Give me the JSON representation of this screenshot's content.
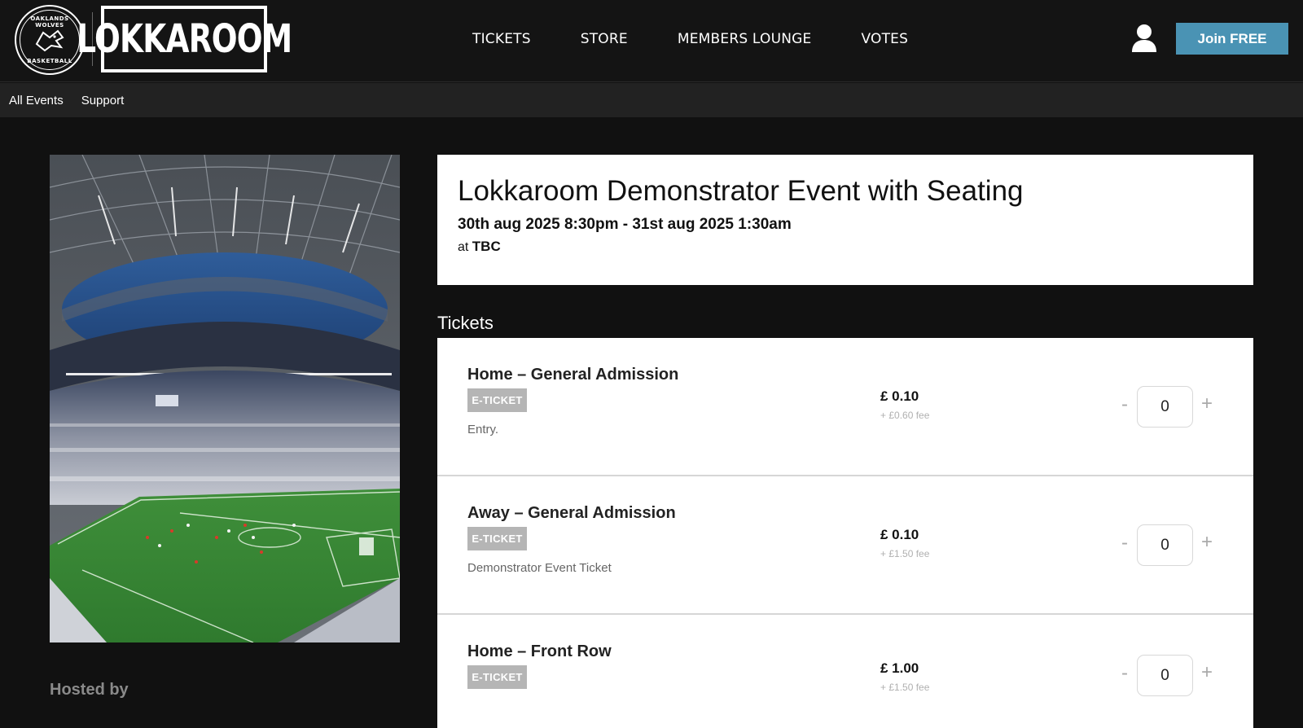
{
  "header": {
    "club_logo": {
      "top_text": "OAKLANDS WOLVES",
      "bottom_text": "BASKETBALL"
    },
    "brand": "LOKKAROOM",
    "nav": [
      "TICKETS",
      "STORE",
      "MEMBERS LOUNGE",
      "VOTES"
    ],
    "user_icon": "user-icon",
    "join_label": "Join FREE",
    "accent_color": "#4a93b4"
  },
  "subnav": [
    "All Events",
    "Support"
  ],
  "event": {
    "title": "Lokkaroom Demonstrator Event with Seating",
    "dates": "30th aug 2025 8:30pm - 31st aug 2025 1:30am",
    "venue_prefix": "at",
    "venue": "TBC"
  },
  "tickets_heading": "Tickets",
  "tickets": [
    {
      "name": "Home – General Admission",
      "badge": "E-TICKET",
      "description": "Entry.",
      "price": "£ 0.10",
      "fee": "+ £0.60 fee",
      "qty": "0",
      "minus": "-",
      "plus": "+"
    },
    {
      "name": "Away – General Admission",
      "badge": "E-TICKET",
      "description": "Demonstrator Event Ticket",
      "price": "£ 0.10",
      "fee": "+ £1.50 fee",
      "qty": "0",
      "minus": "-",
      "plus": "+"
    },
    {
      "name": "Home – Front Row",
      "badge": "E-TICKET",
      "description": "",
      "price": "£ 1.00",
      "fee": "+ £1.50 fee",
      "qty": "0",
      "minus": "-",
      "plus": "+"
    }
  ],
  "hosted_by": "Hosted by"
}
